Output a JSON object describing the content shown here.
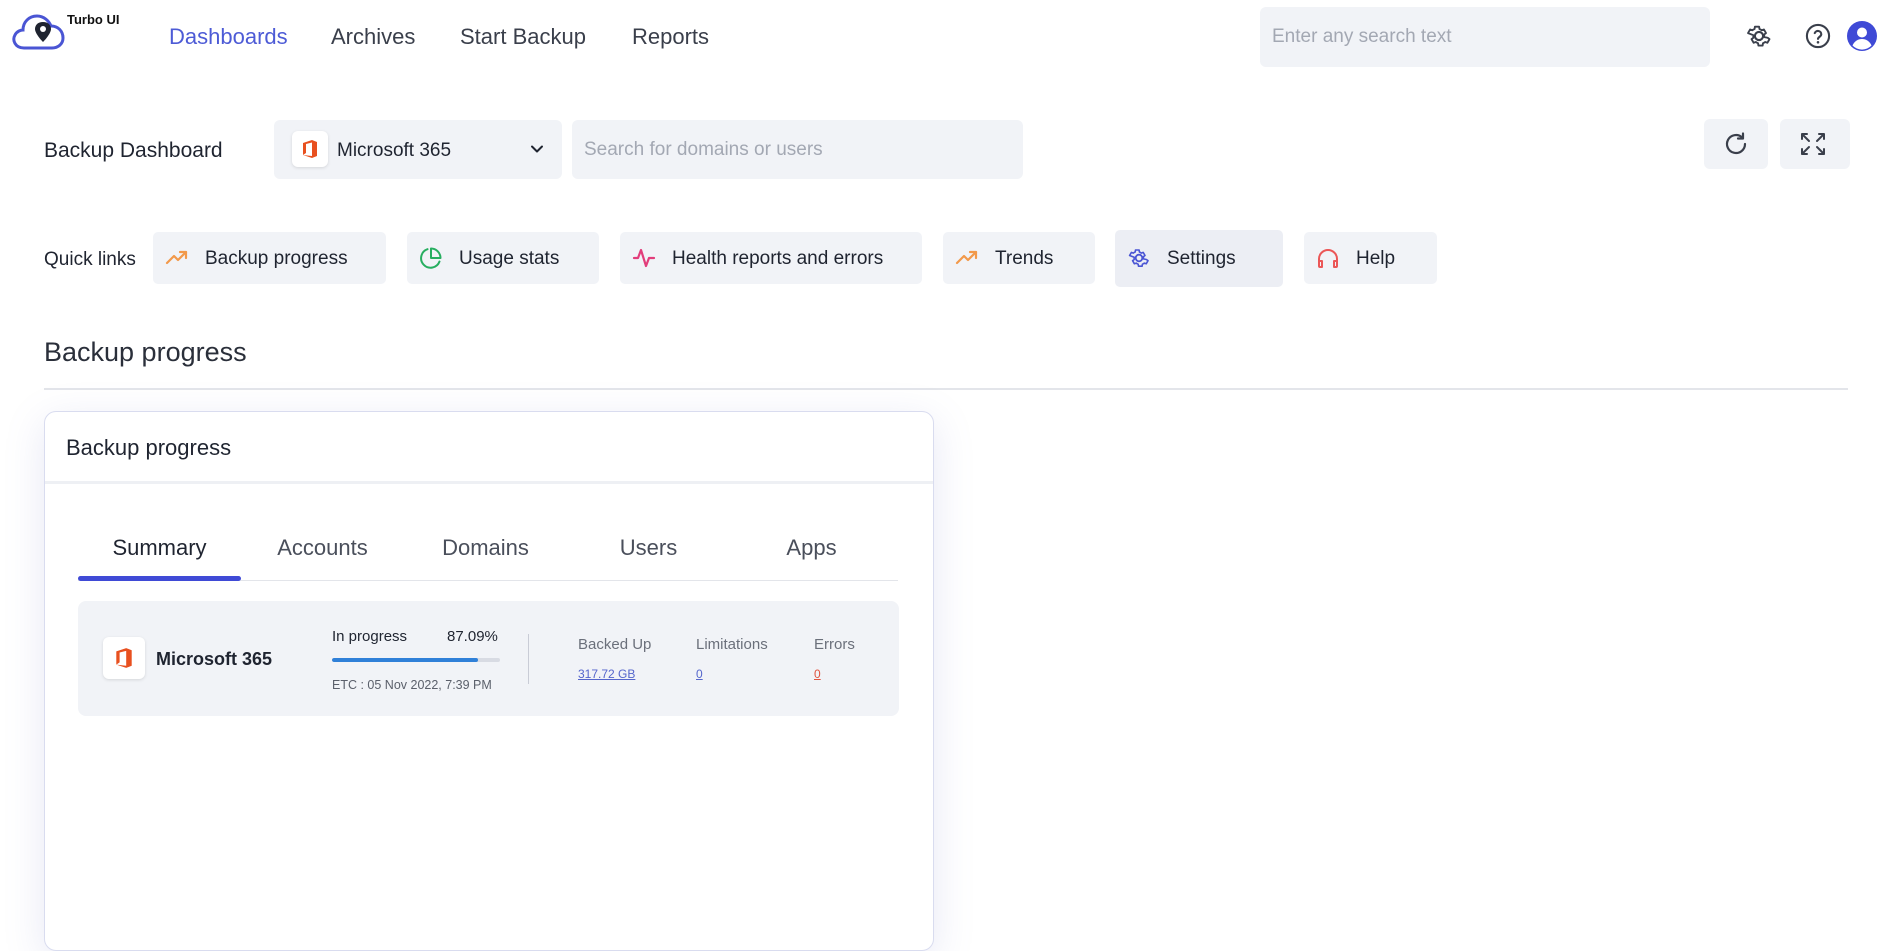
{
  "app": {
    "brand": "Turbo UI",
    "nav": [
      {
        "label": "Dashboards",
        "active": true
      },
      {
        "label": "Archives",
        "active": false
      },
      {
        "label": "Start Backup",
        "active": false
      },
      {
        "label": "Reports",
        "active": false
      }
    ],
    "search_placeholder": "Enter any search text",
    "icons": [
      "gear-icon",
      "help-circle-icon",
      "user-avatar-icon"
    ]
  },
  "header": {
    "title": "Backup Dashboard",
    "product_select": {
      "value": "Microsoft 365",
      "icon": "microsoft-office-icon"
    },
    "domain_search_placeholder": "Search for domains or users",
    "tools": [
      "refresh-icon",
      "fullscreen-icon"
    ]
  },
  "quick_links": {
    "label": "Quick links",
    "items": [
      {
        "label": "Backup progress",
        "icon": "trending-up-icon",
        "color": "#f2994a"
      },
      {
        "label": "Usage stats",
        "icon": "pie-chart-icon",
        "color": "#27ae60"
      },
      {
        "label": "Health reports and errors",
        "icon": "activity-icon",
        "color": "#e23d7b"
      },
      {
        "label": "Trends",
        "icon": "trending-up-icon",
        "color": "#f2994a"
      },
      {
        "label": "Settings",
        "icon": "gear-icon",
        "color": "#4a55d4"
      },
      {
        "label": "Help",
        "icon": "headphones-icon",
        "color": "#eb5757"
      }
    ]
  },
  "section": {
    "title": "Backup progress"
  },
  "card": {
    "title": "Backup progress",
    "tabs": [
      "Summary",
      "Accounts",
      "Domains",
      "Users",
      "Apps"
    ],
    "active_tab": "Summary",
    "summary": {
      "product": "Microsoft 365",
      "status": "In progress",
      "percent": "87.09%",
      "progress_fraction": 0.8709,
      "etc": "ETC : 05 Nov 2022, 7:39 PM",
      "stats": [
        {
          "label": "Backed Up",
          "value": "317.72 GB",
          "color": "#5566cc"
        },
        {
          "label": "Limitations",
          "value": "0",
          "color": "#5566cc"
        },
        {
          "label": "Errors",
          "value": "0",
          "color": "#e0533e"
        }
      ]
    }
  },
  "colors": {
    "accent": "#4d5bd6",
    "surface": "#f1f3f7",
    "progress": "#2f80d8"
  }
}
